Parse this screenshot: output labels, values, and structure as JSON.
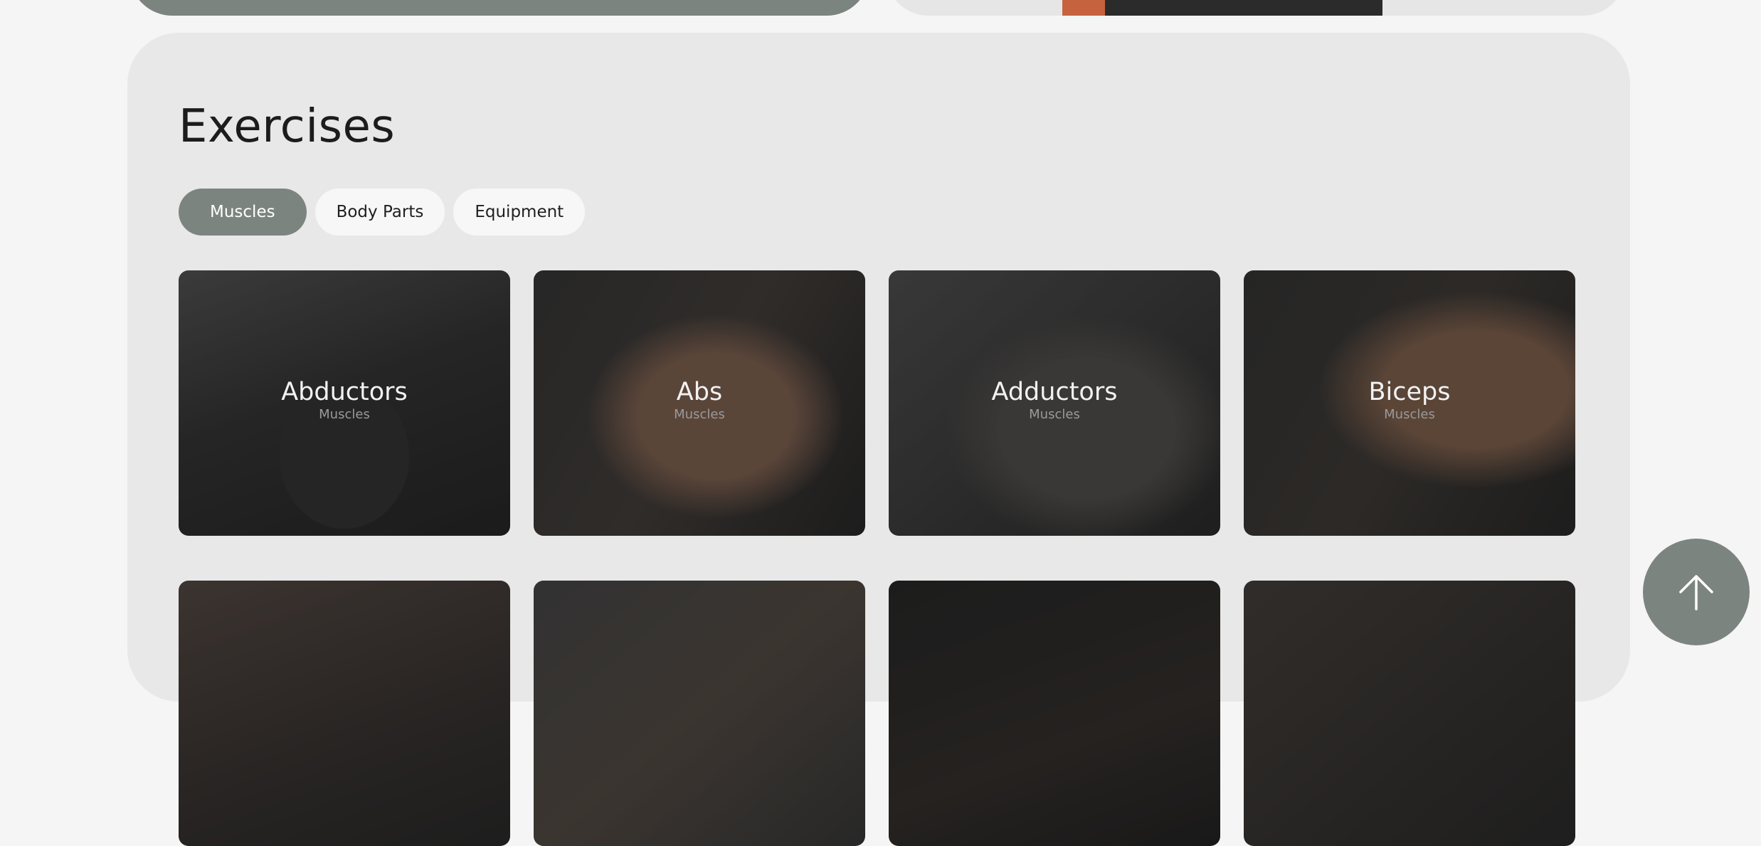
{
  "section": {
    "title": "Exercises"
  },
  "tabs": [
    {
      "label": "Muscles",
      "active": true
    },
    {
      "label": "Body Parts",
      "active": false
    },
    {
      "label": "Equipment",
      "active": false
    }
  ],
  "cards": [
    {
      "name": "Abductors",
      "category": "Muscles"
    },
    {
      "name": "Abs",
      "category": "Muscles"
    },
    {
      "name": "Adductors",
      "category": "Muscles"
    },
    {
      "name": "Biceps",
      "category": "Muscles"
    }
  ],
  "scroll_top": {
    "icon": "arrow-up-icon"
  },
  "colors": {
    "accent": "#7c8480",
    "panel": "#e8e8e8",
    "page": "#f5f5f5"
  }
}
